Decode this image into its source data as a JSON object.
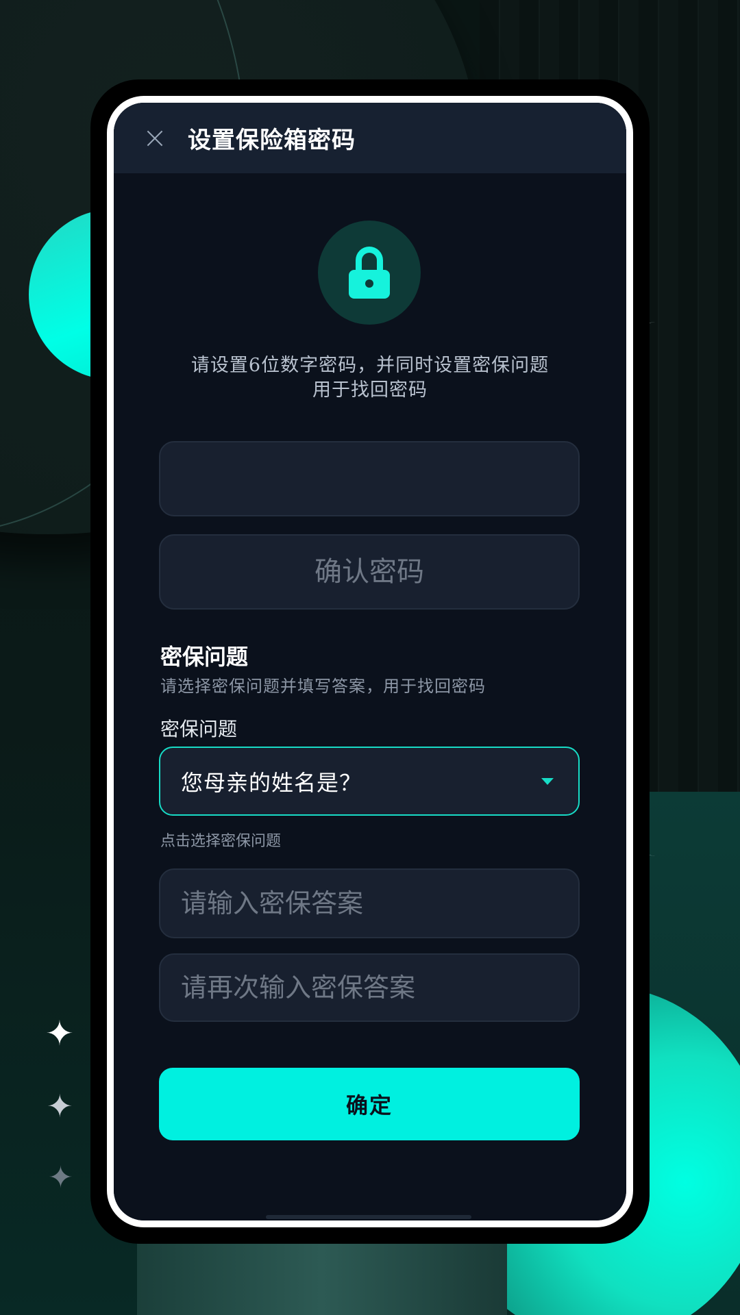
{
  "header": {
    "title": "设置保险箱密码",
    "close_icon": "close-icon"
  },
  "lock": {
    "icon": "lock-icon",
    "color": "#16f2dc"
  },
  "intro": {
    "line1": "请设置6位数字密码，并同时设置密保问题",
    "line2": "用于找回密码"
  },
  "password": {
    "value": "",
    "placeholder": ""
  },
  "confirm_password": {
    "value": "",
    "placeholder": "确认密码"
  },
  "security": {
    "title": "密保问题",
    "subtitle": "请选择密保问题并填写答案，用于找回密码",
    "question_label": "密保问题",
    "selected_question": "您母亲的姓名是？",
    "help_text": "点击选择密保问题",
    "answer_placeholder": "请输入密保答案",
    "answer_repeat_placeholder": "请再次输入密保答案"
  },
  "actions": {
    "confirm_label": "确定"
  },
  "colors": {
    "accent": "#00f0e0",
    "screen_bg": "#0b111c",
    "field_bg": "#18202f",
    "header_bg": "#172131"
  }
}
